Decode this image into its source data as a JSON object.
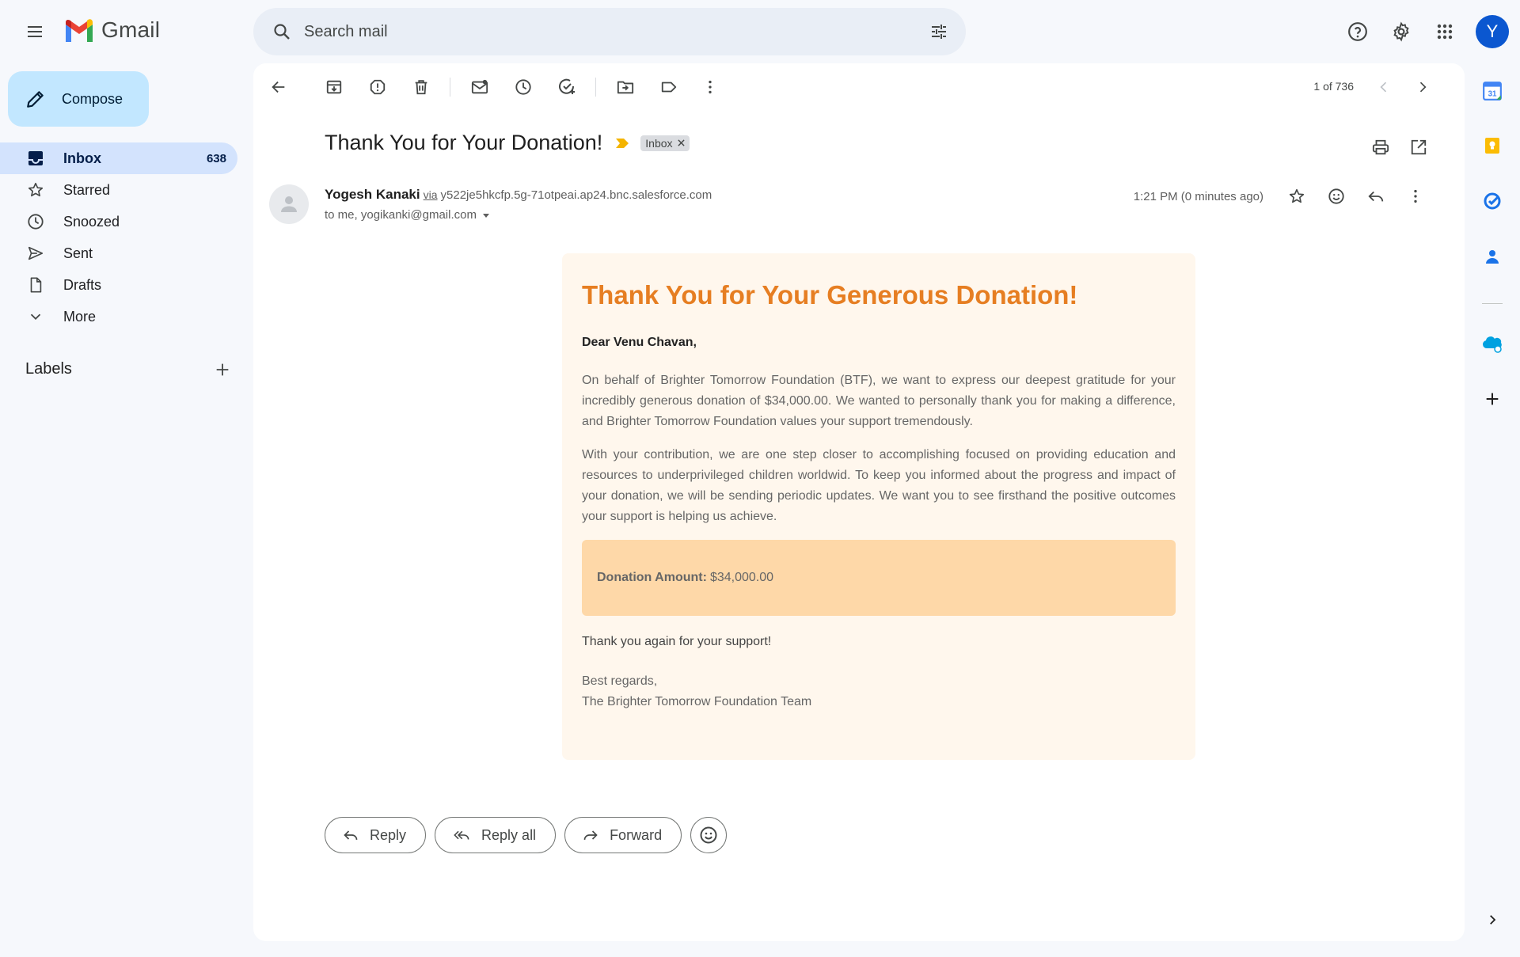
{
  "app": {
    "name": "Gmail"
  },
  "search": {
    "placeholder": "Search mail"
  },
  "account": {
    "initial": "Y"
  },
  "sidebar": {
    "compose_label": "Compose",
    "items": [
      {
        "label": "Inbox",
        "count": "638",
        "icon": "inbox-icon"
      },
      {
        "label": "Starred",
        "count": "",
        "icon": "star-icon"
      },
      {
        "label": "Snoozed",
        "count": "",
        "icon": "clock-icon"
      },
      {
        "label": "Sent",
        "count": "",
        "icon": "send-icon"
      },
      {
        "label": "Drafts",
        "count": "",
        "icon": "draft-icon"
      },
      {
        "label": "More",
        "count": "",
        "icon": "chevron-down-icon"
      }
    ],
    "labels_title": "Labels"
  },
  "toolbar": {
    "pager": "1 of 736"
  },
  "email": {
    "subject": "Thank You for Your Donation!",
    "label_chip": "Inbox",
    "sender_name": "Yogesh Kanaki",
    "via_text": "via",
    "via_address": "y522je5hkcfp.5g-71otpeai.ap24.bnc.salesforce.com",
    "to_line": "to me, yogikanki@gmail.com",
    "time": "1:21 PM (0 minutes ago)",
    "body": {
      "heading": "Thank You for Your Generous Donation!",
      "greeting": "Dear Venu Chavan,",
      "para1": "On behalf of Brighter Tomorrow Foundation (BTF), we want to express our deepest gratitude for your incredibly generous donation of $34,000.00. We wanted to personally thank you for making a difference, and Brighter Tomorrow Foundation values your support tremendously.",
      "para2": "With your contribution, we are one step closer to accomplishing focused on providing education and resources to underprivileged children worldwid. To keep you informed about the progress and impact of your donation, we will be sending periodic updates. We want you to see firsthand the positive outcomes your support is helping us achieve.",
      "amount_label": "Donation Amount:",
      "amount_value": "$34,000.00",
      "thanks": "Thank you again for your support!",
      "regards": "Best regards,",
      "signature": "The Brighter Tomorrow Foundation Team"
    }
  },
  "actions": {
    "reply": "Reply",
    "reply_all": "Reply all",
    "forward": "Forward"
  },
  "colors": {
    "accent": "#0b57d0",
    "heading_orange": "#e67e22",
    "card_bg": "#fff7ed",
    "amount_bg": "#fed8a8"
  }
}
